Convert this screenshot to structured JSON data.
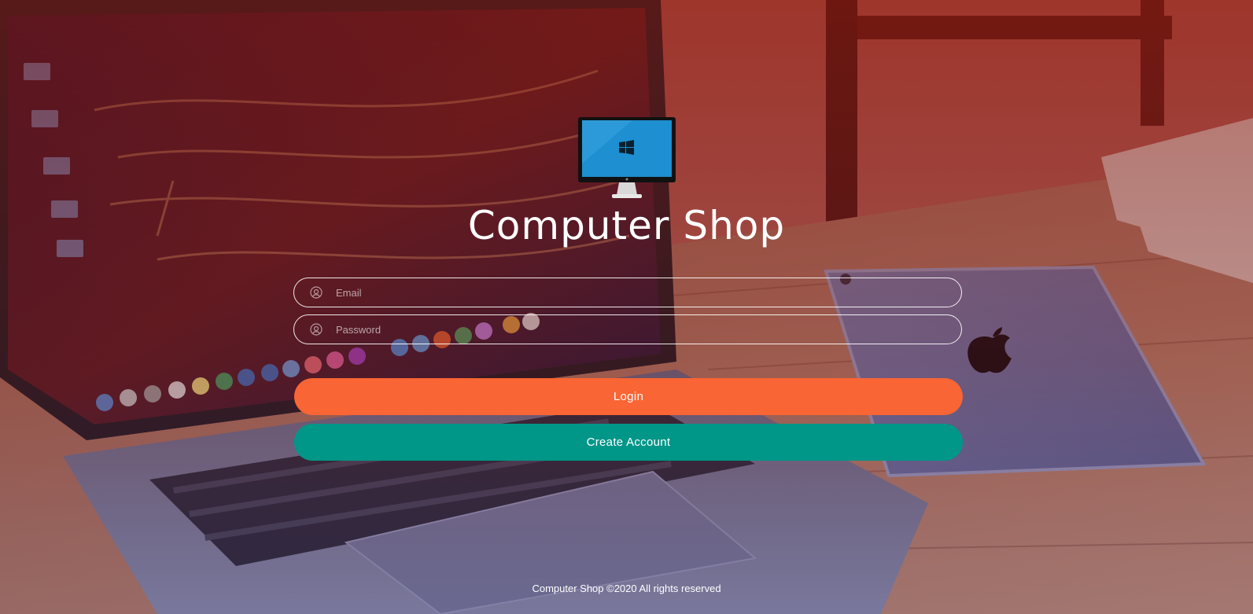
{
  "app": {
    "title": "Computer Shop",
    "logo_icon": "monitor-windows-icon"
  },
  "form": {
    "email": {
      "placeholder": "Email",
      "value": "",
      "icon": "user-icon"
    },
    "password": {
      "placeholder": "Password",
      "value": "",
      "icon": "user-icon"
    },
    "login_label": "Login",
    "create_account_label": "Create Account"
  },
  "footer": {
    "text": "Computer Shop ©2020 All rights reserved"
  },
  "colors": {
    "login_button": "#f96534",
    "create_button": "#009688",
    "overlay": "#8a2a1e"
  }
}
